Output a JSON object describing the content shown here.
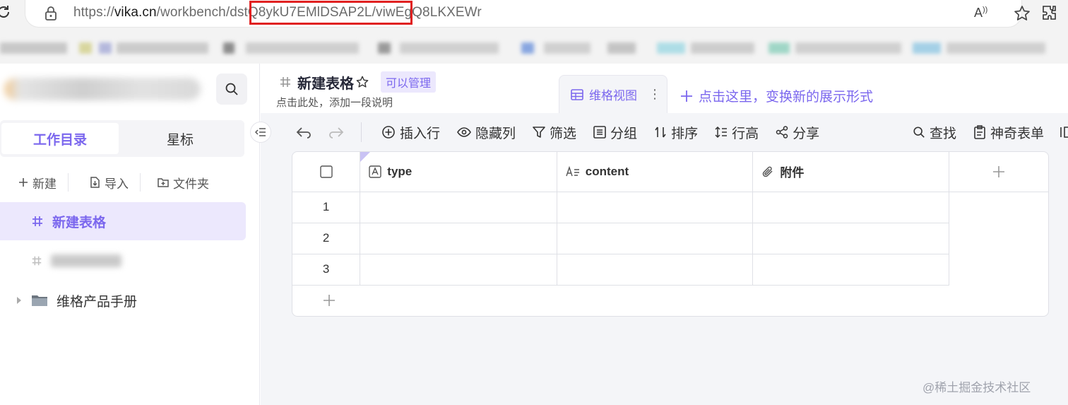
{
  "browser": {
    "url_scheme": "https://",
    "url_domain": "vika.cn",
    "url_path": "/workbench/dstQ8ykU7EMlDSAP2L/viwEgQ8LKXEWr",
    "read_aloud_label": "A",
    "icons": [
      "refresh-icon",
      "lock-icon",
      "read-aloud-icon",
      "favorite-star-icon",
      "extensions-icon"
    ]
  },
  "sidebar": {
    "search_icon": "search-icon",
    "tabs": [
      {
        "label": "工作目录",
        "active": true
      },
      {
        "label": "星标",
        "active": false
      }
    ],
    "actions": [
      {
        "label": "新建",
        "icon": "plus-icon"
      },
      {
        "label": "导入",
        "icon": "import-icon"
      },
      {
        "label": "文件夹",
        "icon": "folder-add-icon"
      }
    ],
    "nodes": [
      {
        "label": "新建表格",
        "icon": "datasheet-icon",
        "active": true
      },
      {
        "label": "维格产品手册",
        "icon": "folder-icon",
        "active": false
      }
    ]
  },
  "header": {
    "title": "新建表格",
    "permission_badge": "可以管理",
    "description": "点击此处，添加一段说明",
    "view_tab": "维格视图",
    "view_more": "⋮",
    "new_view": "点击这里，变换新的展示形式"
  },
  "toolbar": {
    "undo_icon": "undo-icon",
    "redo_icon": "redo-icon",
    "items": [
      {
        "label": "插入行",
        "icon": "insert-row-icon"
      },
      {
        "label": "隐藏列",
        "icon": "eye-icon"
      },
      {
        "label": "筛选",
        "icon": "filter-icon"
      },
      {
        "label": "分组",
        "icon": "group-icon"
      },
      {
        "label": "排序",
        "icon": "sort-icon"
      },
      {
        "label": "行高",
        "icon": "row-height-icon"
      },
      {
        "label": "分享",
        "icon": "share-icon"
      }
    ],
    "right_items": [
      {
        "label": "查找",
        "icon": "search-icon"
      },
      {
        "label": "神奇表单",
        "icon": "form-icon"
      }
    ]
  },
  "grid": {
    "columns": [
      {
        "name": "type",
        "icon": "text-field-icon"
      },
      {
        "name": "content",
        "icon": "long-text-field-icon"
      },
      {
        "name": "附件",
        "icon": "attachment-icon"
      }
    ],
    "rows": [
      {
        "number": "1",
        "type": "",
        "content": "",
        "attachment": ""
      },
      {
        "number": "2",
        "type": "",
        "content": "",
        "attachment": ""
      },
      {
        "number": "3",
        "type": "",
        "content": "",
        "attachment": ""
      }
    ]
  },
  "watermark": "@稀土掘金技术社区",
  "colors": {
    "accent": "#7b67ee",
    "accent_bg": "#ece8fd",
    "highlight_box": "#e02020"
  }
}
